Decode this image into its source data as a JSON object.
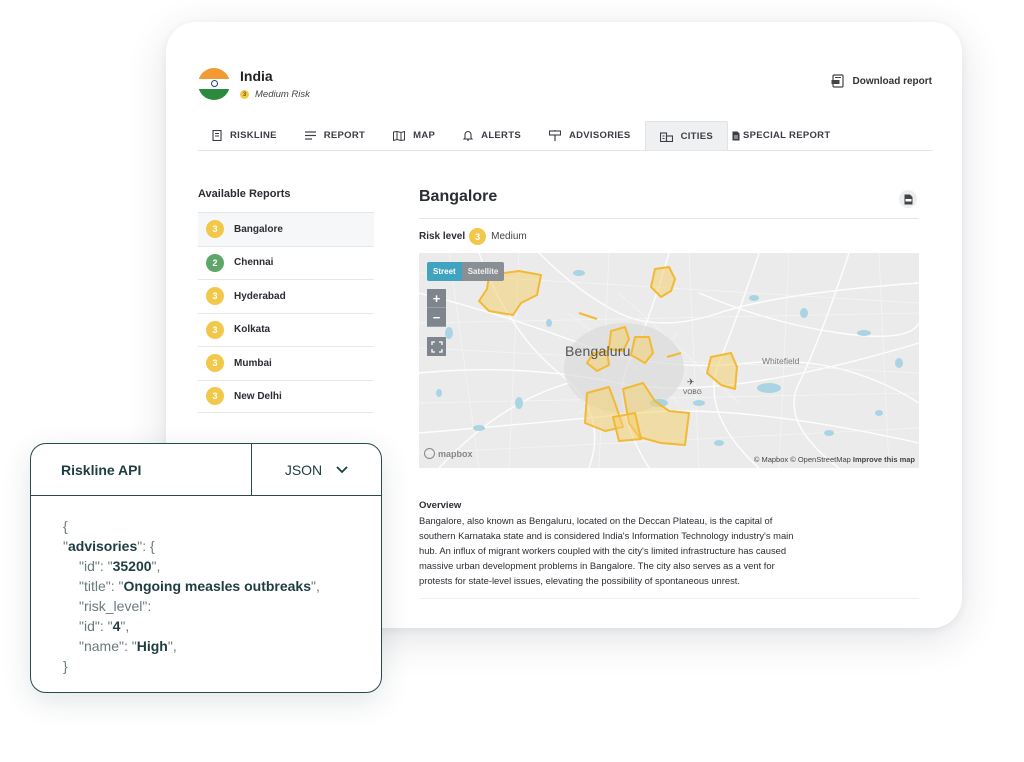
{
  "country": {
    "name": "India",
    "risk_badge": "3",
    "risk_label": "Medium Risk"
  },
  "header": {
    "download_label": "Download report"
  },
  "tabs": [
    {
      "label": "RISKLINE",
      "icon": "document-icon"
    },
    {
      "label": "REPORT",
      "icon": "lines-icon"
    },
    {
      "label": "MAP",
      "icon": "map-icon"
    },
    {
      "label": "ALERTS",
      "icon": "bell-icon"
    },
    {
      "label": "ADVISORIES",
      "icon": "signpost-icon"
    },
    {
      "label": "CITIES",
      "icon": "buildings-icon",
      "active": true
    },
    {
      "label": "SPECIAL REPORT",
      "icon": "file-icon"
    }
  ],
  "sidebar": {
    "title": "Available Reports",
    "items": [
      {
        "level": "3",
        "name": "Bangalore",
        "color": "#f2c84b"
      },
      {
        "level": "2",
        "name": "Chennai",
        "color": "#5fa66a"
      },
      {
        "level": "3",
        "name": "Hyderabad",
        "color": "#f2c84b"
      },
      {
        "level": "3",
        "name": "Kolkata",
        "color": "#f2c84b"
      },
      {
        "level": "3",
        "name": "Mumbai",
        "color": "#f2c84b"
      },
      {
        "level": "3",
        "name": "New Delhi",
        "color": "#f2c84b"
      }
    ]
  },
  "city": {
    "name": "Bangalore",
    "risk_label": "Risk level",
    "risk_level": "3",
    "risk_text": "Medium",
    "risk_color": "#f2c84b"
  },
  "map": {
    "street_label": "Street",
    "satellite_label": "Satellite",
    "zoom_in": "+",
    "zoom_out": "−",
    "city_label": "Bengaluru",
    "whitefield_label": "Whitefield",
    "airport_label": "VOBG",
    "logo_text": "mapbox",
    "attribution": "© Mapbox © OpenStreetMap",
    "improve_label": "Improve this map"
  },
  "overview": {
    "heading": "Overview",
    "text": "Bangalore, also known as Bengaluru, located on the Deccan Plateau, is the capital of southern Karnataka state and is considered India's Information Technology industry's main hub. An influx of migrant workers coupled with the city's limited infrastructure has caused massive urban development problems in Bangalore. The city also serves as a vent for protests for state-level issues, elevating the possibility of spontaneous unrest."
  },
  "api": {
    "title": "Riskline API",
    "format": "JSON",
    "lines": {
      "open": "{",
      "advisories_key": "advisories",
      "id_key": "id",
      "id_val": "35200",
      "title_key": "title",
      "title_val": "Ongoing measles outbreaks",
      "risk_key": "risk_level",
      "rid_key": "id",
      "rid_val": "4",
      "name_key": "name",
      "name_val": "High",
      "close": "}"
    }
  }
}
